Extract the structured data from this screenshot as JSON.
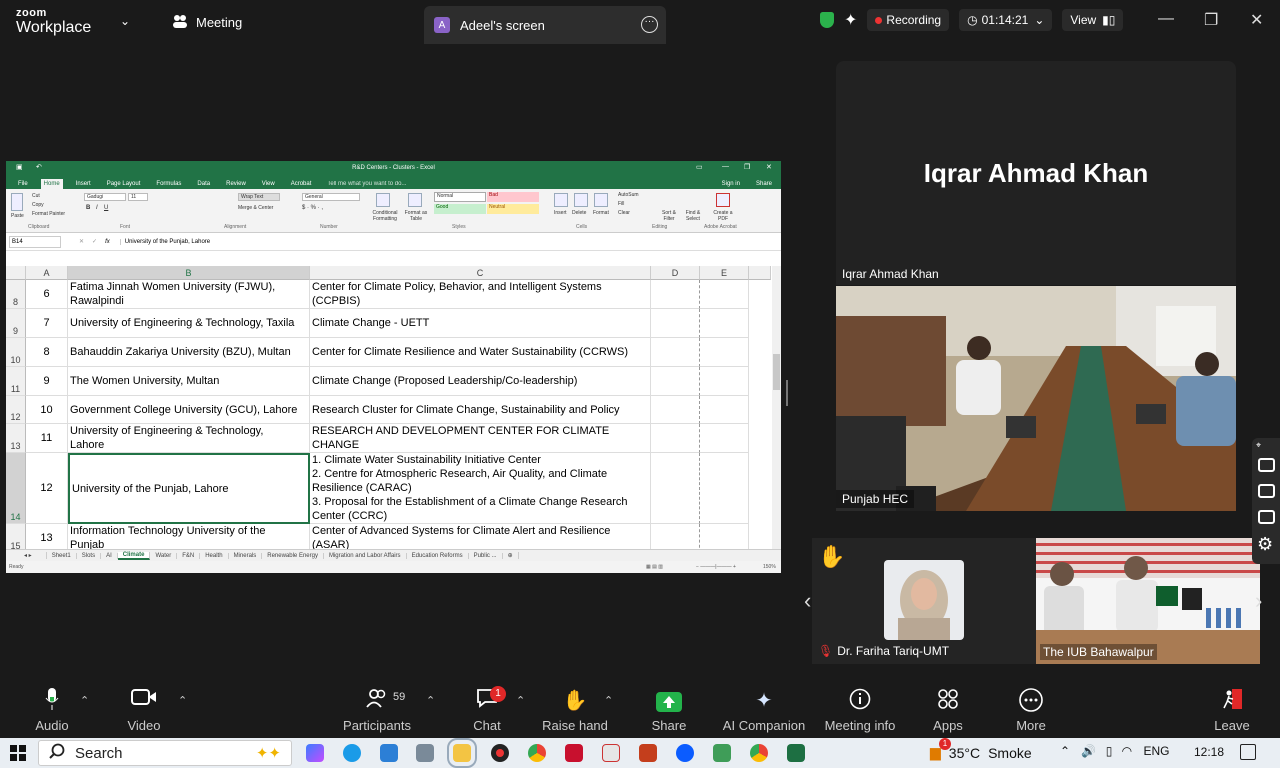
{
  "zoom": {
    "logo_top": "zoom",
    "logo_bottom": "Workplace",
    "meeting_tab": "Meeting",
    "screen_tab_initial": "A",
    "screen_tab": "Adeel's screen",
    "recording_label": "Recording",
    "timer": "01:14:21",
    "view_label": "View"
  },
  "excel": {
    "window_title": "R&D Centers - Clusters - Excel",
    "ribbon_tabs": [
      "File",
      "Home",
      "Insert",
      "Page Layout",
      "Formulas",
      "Data",
      "Review",
      "View",
      "Acrobat",
      "Tell me what you want to do...",
      "Sign in",
      "Share"
    ],
    "ribbon_groups": [
      "Clipboard",
      "Font",
      "Alignment",
      "Number",
      "Styles",
      "Cells",
      "Editing",
      "Adobe Acrobat"
    ],
    "ribbon_buttons": {
      "paste": "Paste",
      "cut": "Cut",
      "copy": "Copy",
      "format_painter": "Format Painter",
      "font_name": "Gadugi",
      "font_size": "11",
      "wrap_text": "Wrap Text",
      "merge_center": "Merge & Center",
      "number_format": "General",
      "conditional": "Conditional Formatting",
      "format_table": "Format as Table",
      "style_normal": "Normal",
      "style_bad": "Bad",
      "style_good": "Good",
      "style_neutral": "Neutral",
      "insert": "Insert",
      "delete": "Delete",
      "format": "Format",
      "autosum": "AutoSum",
      "fill": "Fill",
      "clear": "Clear",
      "sort_filter": "Sort & Filter",
      "find_select": "Find & Select",
      "create_pdf": "Create a PDF"
    },
    "name_box": "B14",
    "formula": "University of the Punjab, Lahore",
    "columns": [
      "A",
      "B",
      "C",
      "D",
      "E"
    ],
    "rows": [
      {
        "row": "8",
        "a": "6",
        "b": "Fatima Jinnah Women University (FJWU),\nRawalpindi",
        "c": "Center for Climate Policy, Behavior, and Intelligent Systems\n(CCPBIS)"
      },
      {
        "row": "9",
        "a": "7",
        "b": "University of Engineering & Technology, Taxila",
        "c": "Climate Change - UETT"
      },
      {
        "row": "10",
        "a": "8",
        "b": "Bahauddin Zakariya University (BZU), Multan",
        "c": "Center for Climate Resilience and Water Sustainability (CCRWS)"
      },
      {
        "row": "11",
        "a": "9",
        "b": "The Women University, Multan",
        "c": "Climate Change (Proposed Leadership/Co-leadership)"
      },
      {
        "row": "12",
        "a": "10",
        "b": "Government College University (GCU), Lahore",
        "c": "Research Cluster for Climate Change, Sustainability and Policy"
      },
      {
        "row": "13",
        "a": "11",
        "b": "University of Engineering & Technology,\nLahore",
        "c": "RESEARCH AND DEVELOPMENT CENTER FOR CLIMATE CHANGE"
      },
      {
        "row": "14",
        "a": "12",
        "b": "University of the Punjab, Lahore",
        "c": "1. Climate Water Sustainability Initiative Center\n2. Centre for Atmospheric Research, Air Quality, and Climate\nResilience (CARAC)\n3. Proposal for the Establishment of a Climate Change Research\nCenter (CCRC)"
      },
      {
        "row": "15",
        "a": "13",
        "b": "Information Technology University of the\nPunjab",
        "c": "Center of Advanced Systems for Climate Alert and Resilience\n(ASAR)"
      }
    ],
    "sheet_tabs": [
      "Sheet1",
      "Slots",
      "AI",
      "Climate",
      "Water",
      "F&N",
      "Health",
      "Minerals",
      "Renewable Energy",
      "Migration and Labor Affairs",
      "Education Reforms",
      "Public ..."
    ],
    "active_sheet": "Climate",
    "status": "Ready",
    "zoom_level": "150%"
  },
  "participants": {
    "speaker_name": "Iqrar Ahmad Khan",
    "speaker_label": "Iqrar Ahmad Khan",
    "video_label": "Punjab HEC",
    "tile1_name": "Dr. Fariha Tariq-UMT",
    "tile2_name": "The IUB Bahawalpur"
  },
  "toolbar": {
    "audio": "Audio",
    "video": "Video",
    "participants": "Participants",
    "participants_count": "59",
    "chat": "Chat",
    "chat_badge": "1",
    "raise_hand": "Raise hand",
    "share": "Share",
    "ai_companion": "AI Companion",
    "meeting_info": "Meeting info",
    "apps": "Apps",
    "more": "More",
    "leave": "Leave"
  },
  "taskbar": {
    "search": "Search",
    "weather_badge": "1",
    "temperature": "35°C",
    "weather": "Smoke",
    "language": "ENG",
    "time": "12:18"
  },
  "colors": {
    "excel_green": "#217346",
    "zoom_share": "#23b34b",
    "rec_red": "#e33333"
  }
}
